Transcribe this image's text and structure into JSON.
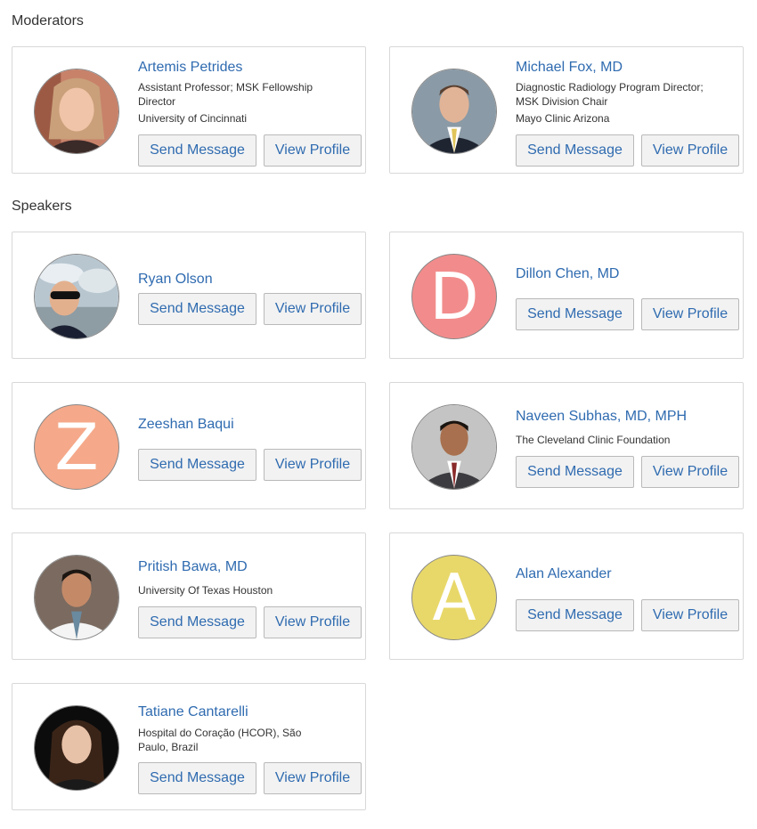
{
  "sections": {
    "moderators": "Moderators",
    "speakers": "Speakers"
  },
  "buttons": {
    "send_message": "Send Message",
    "view_profile": "View Profile"
  },
  "people": {
    "artemis": {
      "name": "Artemis Petrides",
      "title": "Assistant Professor; MSK Fellowship Director",
      "org": "University of Cincinnati",
      "avatar": "photo"
    },
    "michael": {
      "name": "Michael Fox, MD",
      "title": "Diagnostic Radiology Program Director; MSK Division Chair",
      "org": "Mayo Clinic Arizona",
      "avatar": "photo"
    },
    "ryan": {
      "name": "Ryan Olson",
      "avatar": "photo"
    },
    "dillon": {
      "name": "Dillon Chen, MD",
      "avatar_letter": "D",
      "avatar_color": "#f28c8c"
    },
    "zeeshan": {
      "name": "Zeeshan Baqui",
      "avatar_letter": "Z",
      "avatar_color": "#f5a98a"
    },
    "naveen": {
      "name": "Naveen Subhas, MD, MPH",
      "org": "The Cleveland Clinic Foundation",
      "avatar": "photo"
    },
    "pritish": {
      "name": "Pritish Bawa, MD",
      "org": "University Of Texas Houston",
      "avatar": "photo"
    },
    "alan": {
      "name": "Alan Alexander",
      "avatar_letter": "A",
      "avatar_color": "#e8d86a"
    },
    "tatiane": {
      "name": "Tatiane Cantarelli",
      "org": "Hospital do Coração (HCOR), São Paulo, Brazil",
      "avatar": "photo"
    }
  }
}
